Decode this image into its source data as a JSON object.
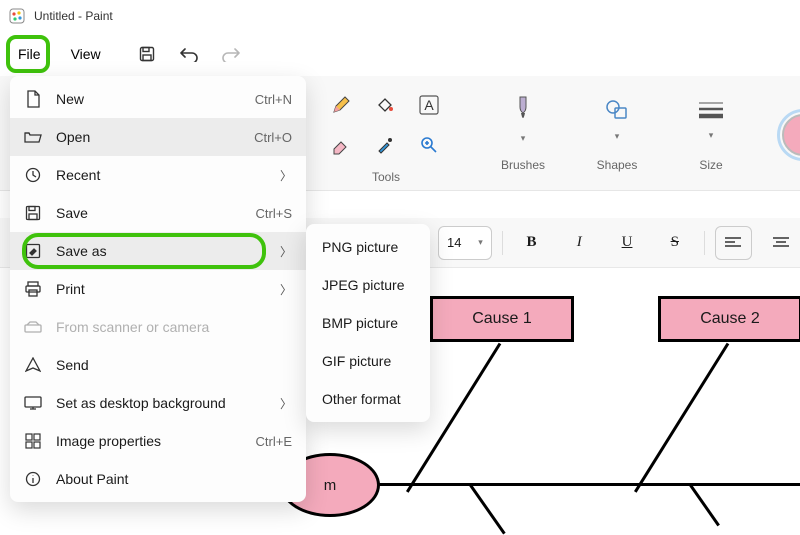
{
  "window": {
    "title": "Untitled - Paint"
  },
  "menubar": {
    "file": "File",
    "view": "View"
  },
  "file_menu": {
    "items": [
      {
        "label": "New",
        "shortcut": "Ctrl+N",
        "icon": "new"
      },
      {
        "label": "Open",
        "shortcut": "Ctrl+O",
        "icon": "open",
        "hover": true
      },
      {
        "label": "Recent",
        "icon": "recent",
        "arrow": true
      },
      {
        "label": "Save",
        "shortcut": "Ctrl+S",
        "icon": "save"
      },
      {
        "label": "Save as",
        "icon": "saveas",
        "arrow": true,
        "hover": true,
        "highlight": true
      },
      {
        "label": "Print",
        "icon": "print",
        "arrow": true
      },
      {
        "label": "From scanner or camera",
        "icon": "scanner",
        "disabled": true
      },
      {
        "label": "Send",
        "icon": "send"
      },
      {
        "label": "Set as desktop background",
        "icon": "desktop",
        "arrow": true
      },
      {
        "label": "Image properties",
        "shortcut": "Ctrl+E",
        "icon": "props"
      },
      {
        "label": "About Paint",
        "icon": "about"
      }
    ]
  },
  "saveas_submenu": {
    "items": [
      {
        "label": "PNG picture"
      },
      {
        "label": "JPEG picture"
      },
      {
        "label": "BMP picture"
      },
      {
        "label": "GIF picture"
      },
      {
        "label": "Other format"
      }
    ]
  },
  "ribbon": {
    "tools_label": "Tools",
    "brushes_label": "Brushes",
    "shapes_label": "Shapes",
    "size_label": "Size"
  },
  "colors": {
    "primary": "#f4aabc",
    "swatches": [
      "#000000",
      "#7b7b7b",
      "#ffffff",
      "#f4aabc"
    ]
  },
  "text_format": {
    "font_size": "14"
  },
  "canvas": {
    "cause1": "Cause 1",
    "cause2": "Cause 2",
    "oval": "m"
  }
}
